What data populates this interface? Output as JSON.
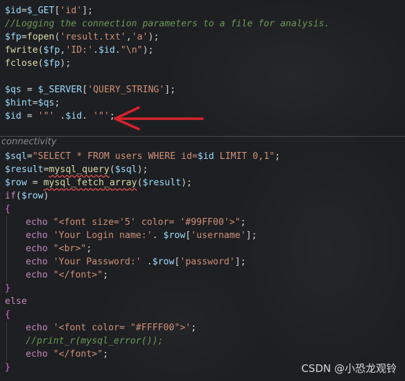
{
  "editor": {
    "block1": [
      {
        "t": [
          [
            "var",
            "$id"
          ],
          [
            "pl",
            "="
          ],
          [
            "var",
            "$_GET"
          ],
          [
            "pl",
            "["
          ],
          [
            "str",
            "'id'"
          ],
          [
            "pl",
            "];"
          ]
        ]
      },
      {
        "t": [
          [
            "cm",
            "//Logging the connection parameters to a file for analysis."
          ]
        ]
      },
      {
        "t": [
          [
            "var",
            "$fp"
          ],
          [
            "pl",
            "="
          ],
          [
            "fn",
            "fopen"
          ],
          [
            "pl",
            "("
          ],
          [
            "str",
            "'result.txt'"
          ],
          [
            "pl",
            ","
          ],
          [
            "str",
            "'a'"
          ],
          [
            "pl",
            ");"
          ]
        ]
      },
      {
        "t": [
          [
            "fn",
            "fwrite"
          ],
          [
            "pl",
            "("
          ],
          [
            "var",
            "$fp"
          ],
          [
            "pl",
            ","
          ],
          [
            "str",
            "'ID:'"
          ],
          [
            "pl",
            "."
          ],
          [
            "var",
            "$id"
          ],
          [
            "pl",
            "."
          ],
          [
            "str",
            "\"\\n\""
          ],
          [
            "pl",
            ");"
          ]
        ]
      },
      {
        "t": [
          [
            "fn",
            "fclose"
          ],
          [
            "pl",
            "("
          ],
          [
            "var",
            "$fp"
          ],
          [
            "pl",
            ");"
          ]
        ]
      },
      {
        "t": []
      },
      {
        "t": [
          [
            "var",
            "$qs"
          ],
          [
            "pl",
            " = "
          ],
          [
            "var",
            "$_SERVER"
          ],
          [
            "pl",
            "["
          ],
          [
            "str",
            "'QUERY_STRING'"
          ],
          [
            "pl",
            "];"
          ]
        ]
      },
      {
        "t": [
          [
            "var",
            "$hint"
          ],
          [
            "pl",
            "="
          ],
          [
            "var",
            "$qs"
          ],
          [
            "pl",
            ";"
          ]
        ]
      },
      {
        "t": [
          [
            "var",
            "$id"
          ],
          [
            "pl",
            " = "
          ],
          [
            "str",
            "'\"'"
          ],
          [
            "pl",
            " ."
          ],
          [
            "var",
            "$id"
          ],
          [
            "pl",
            ". "
          ],
          [
            "str",
            "'\"'"
          ],
          [
            "pl",
            ";"
          ]
        ]
      }
    ],
    "separator_label": "connectivity",
    "block2": [
      {
        "t": [
          [
            "var",
            "$sql"
          ],
          [
            "pl",
            "="
          ],
          [
            "str",
            "\"SELECT * FROM users WHERE id="
          ],
          [
            "var",
            "$id"
          ],
          [
            "str",
            " LIMIT 0,1\""
          ],
          [
            "pl",
            ";"
          ]
        ]
      },
      {
        "t": [
          [
            "var",
            "$result"
          ],
          [
            "pl",
            "="
          ],
          [
            "fn",
            "mysql_query",
            "squig"
          ],
          [
            "pl",
            "("
          ],
          [
            "var",
            "$sql"
          ],
          [
            "pl",
            ");"
          ]
        ]
      },
      {
        "t": [
          [
            "var",
            "$row"
          ],
          [
            "pl",
            " = "
          ],
          [
            "fn",
            "mysql_fetch_array",
            "squig"
          ],
          [
            "pl",
            "("
          ],
          [
            "var",
            "$result"
          ],
          [
            "pl",
            ");"
          ]
        ]
      },
      {
        "t": [
          [
            "kw",
            "if"
          ],
          [
            "pl",
            "("
          ],
          [
            "var",
            "$row"
          ],
          [
            "pl",
            ")"
          ]
        ]
      },
      {
        "t": [
          [
            "br",
            "{"
          ]
        ]
      },
      {
        "i": 1,
        "t": [
          [
            "kw",
            "echo"
          ],
          [
            "pl",
            " "
          ],
          [
            "str",
            "\"<font size='5' color= '#99FF00'>\""
          ],
          [
            "pl",
            ";"
          ]
        ]
      },
      {
        "i": 1,
        "t": [
          [
            "kw",
            "echo"
          ],
          [
            "pl",
            " "
          ],
          [
            "str",
            "'Your Login name:'"
          ],
          [
            "pl",
            ". "
          ],
          [
            "var",
            "$row"
          ],
          [
            "pl",
            "["
          ],
          [
            "str",
            "'username'"
          ],
          [
            "pl",
            "];"
          ]
        ]
      },
      {
        "i": 1,
        "t": [
          [
            "kw",
            "echo"
          ],
          [
            "pl",
            " "
          ],
          [
            "str",
            "\"<br>\""
          ],
          [
            "pl",
            ";"
          ]
        ]
      },
      {
        "i": 1,
        "t": [
          [
            "kw",
            "echo"
          ],
          [
            "pl",
            " "
          ],
          [
            "str",
            "'Your Password:'"
          ],
          [
            "pl",
            " ."
          ],
          [
            "var",
            "$row"
          ],
          [
            "pl",
            "["
          ],
          [
            "str",
            "'password'"
          ],
          [
            "pl",
            "];"
          ]
        ]
      },
      {
        "i": 1,
        "t": [
          [
            "kw",
            "echo"
          ],
          [
            "pl",
            " "
          ],
          [
            "str",
            "\"</font>\""
          ],
          [
            "pl",
            ";"
          ]
        ]
      },
      {
        "t": [
          [
            "br",
            "}"
          ]
        ]
      },
      {
        "t": [
          [
            "kw",
            "else"
          ]
        ]
      },
      {
        "t": [
          [
            "br",
            "{"
          ]
        ]
      },
      {
        "i": 1,
        "t": [
          [
            "kw",
            "echo"
          ],
          [
            "pl",
            " "
          ],
          [
            "str",
            "'<font color= \"#FFFF00\">'"
          ],
          [
            "pl",
            ";"
          ]
        ]
      },
      {
        "i": 1,
        "t": [
          [
            "cm",
            "//print_r(mysql_error());"
          ]
        ]
      },
      {
        "i": 1,
        "t": [
          [
            "kw",
            "echo"
          ],
          [
            "pl",
            " "
          ],
          [
            "str",
            "\"</font>\""
          ],
          [
            "pl",
            ";"
          ]
        ]
      },
      {
        "t": [
          [
            "br",
            "}"
          ]
        ]
      }
    ]
  },
  "watermark": "CSDN @小恐龙观铃",
  "colors": {
    "background": "#1e1f22",
    "arrow": "#d9232a"
  },
  "annotation": "red-arrow-icon"
}
